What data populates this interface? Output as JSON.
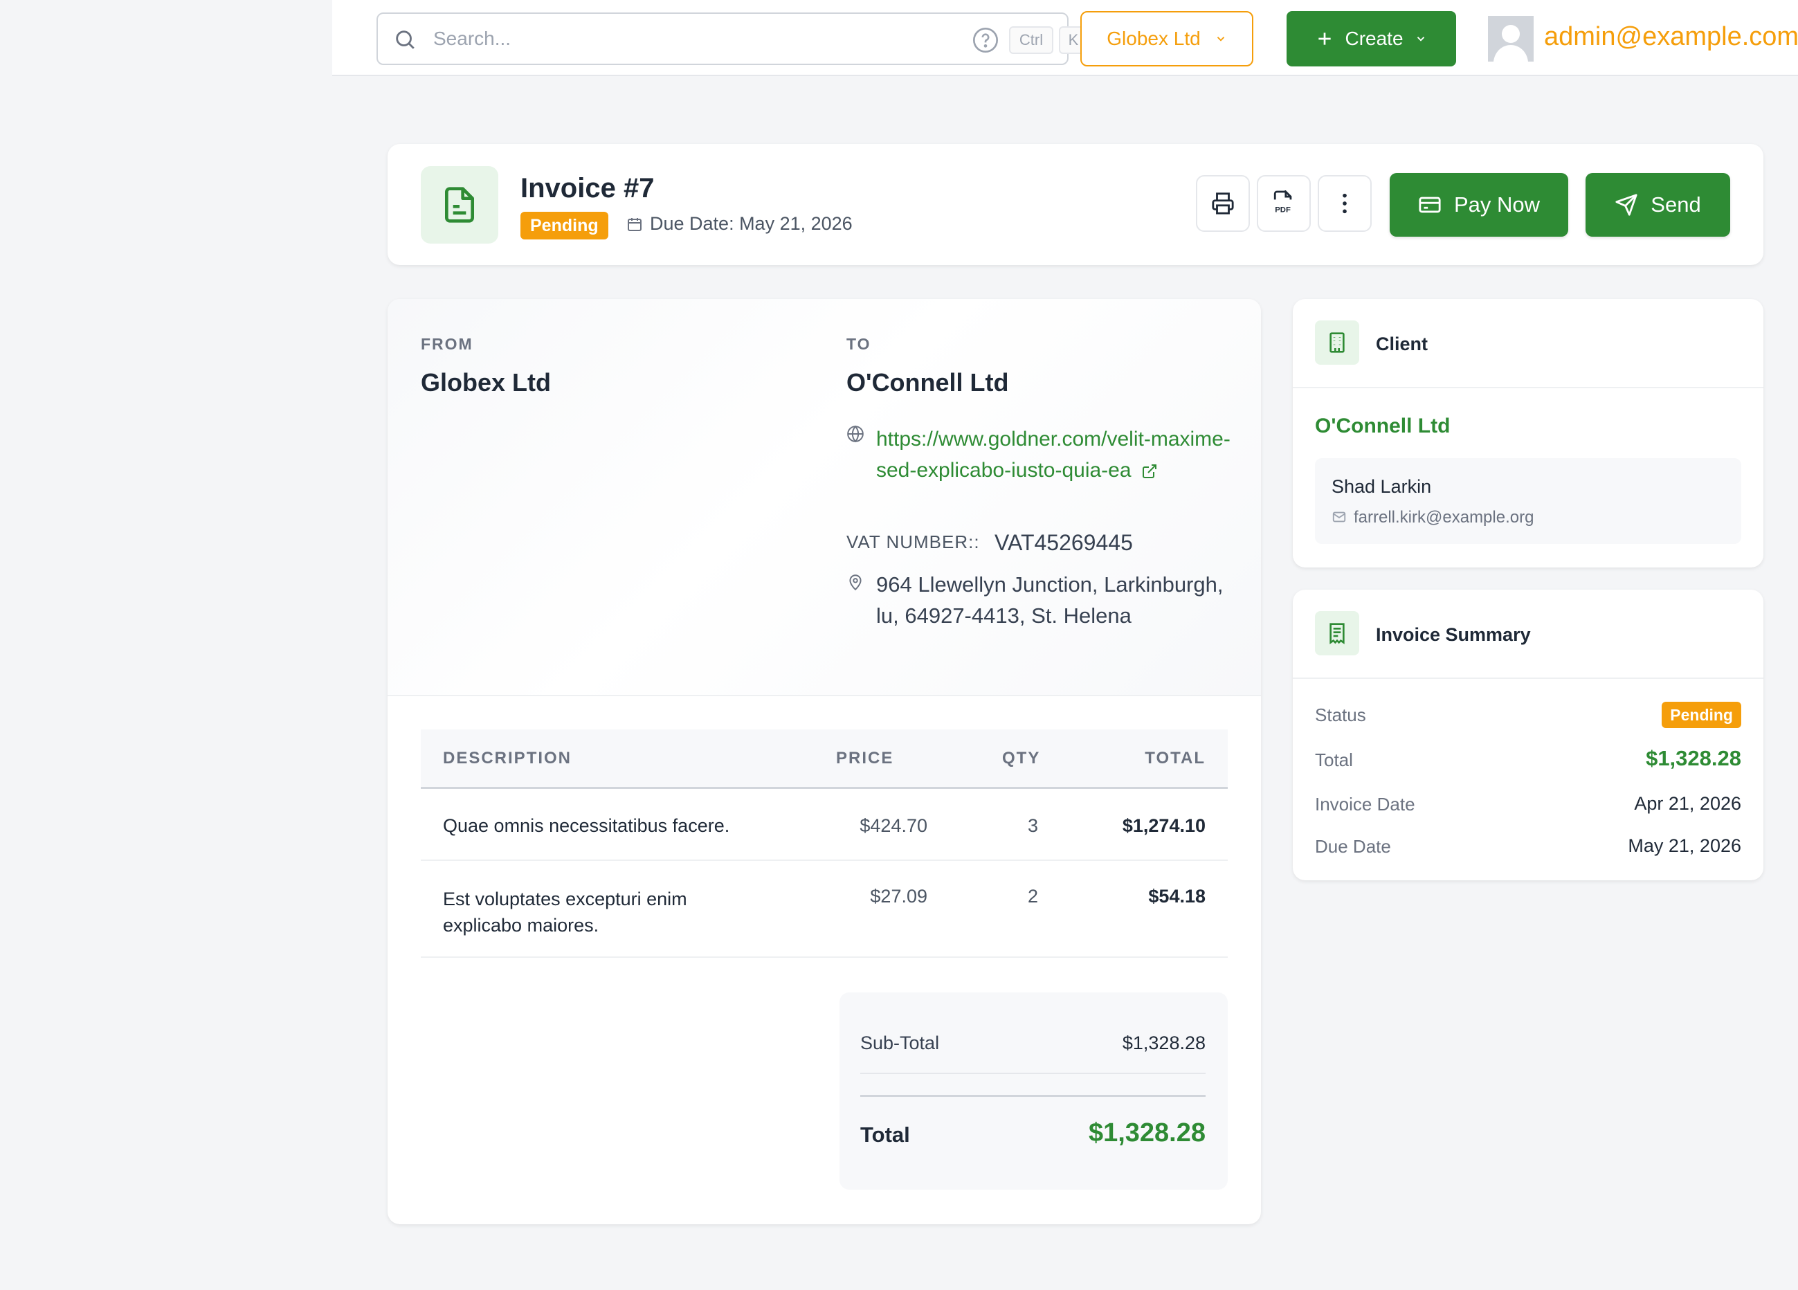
{
  "topbar": {
    "search_placeholder": "Search...",
    "kbd_ctrl": "Ctrl",
    "kbd_k": "K",
    "company": "Globex Ltd",
    "create_label": "Create",
    "user_email": "admin@example.com"
  },
  "header": {
    "title": "Invoice #7",
    "status": "Pending",
    "due_date": "Due Date: May 21, 2026",
    "pay_now": "Pay Now",
    "send": "Send"
  },
  "invoice": {
    "from_label": "FROM",
    "from_name": "Globex Ltd",
    "to_label": "TO",
    "to_name": "O'Connell Ltd",
    "website": "https://www.goldner.com/velit-maxime-sed-explicabo-iusto-quia-ea",
    "vat_label": "VAT NUMBER::",
    "vat_value": "VAT45269445",
    "address": "964 Llewellyn Junction, Larkinburgh, lu, 64927-4413, St. Helena",
    "columns": {
      "description": "DESCRIPTION",
      "price": "PRICE",
      "qty": "QTY",
      "total": "TOTAL"
    },
    "items": [
      {
        "description": "Quae omnis necessitatibus facere.",
        "price": "$424.70",
        "qty": "3",
        "total": "$1,274.10"
      },
      {
        "description": "Est voluptates excepturi enim explicabo maiores.",
        "price": "$27.09",
        "qty": "2",
        "total": "$54.18"
      }
    ],
    "subtotal_label": "Sub-Total",
    "subtotal_value": "$1,328.28",
    "total_label": "Total",
    "total_value": "$1,328.28"
  },
  "client_card": {
    "title": "Client",
    "company": "O'Connell Ltd",
    "contact_name": "Shad Larkin",
    "contact_email": "farrell.kirk@example.org"
  },
  "summary_card": {
    "title": "Invoice Summary",
    "status_label": "Status",
    "status_value": "Pending",
    "total_label": "Total",
    "total_value": "$1,328.28",
    "invoice_date_label": "Invoice Date",
    "invoice_date_value": "Apr 21, 2026",
    "due_date_label": "Due Date",
    "due_date_value": "May 21, 2026"
  },
  "colors": {
    "brand_green": "#2e8b34",
    "warning_orange": "#f59e0b",
    "background": "#f4f5f7"
  },
  "icons": [
    "search-icon",
    "help-icon",
    "chevron-down-icon",
    "plus-icon",
    "user-avatar",
    "document-icon",
    "calendar-icon",
    "printer-icon",
    "pdf-icon",
    "more-vertical-icon",
    "credit-card-icon",
    "send-icon",
    "globe-icon",
    "external-link-icon",
    "map-pin-icon",
    "building-icon",
    "mail-icon",
    "receipt-icon"
  ]
}
